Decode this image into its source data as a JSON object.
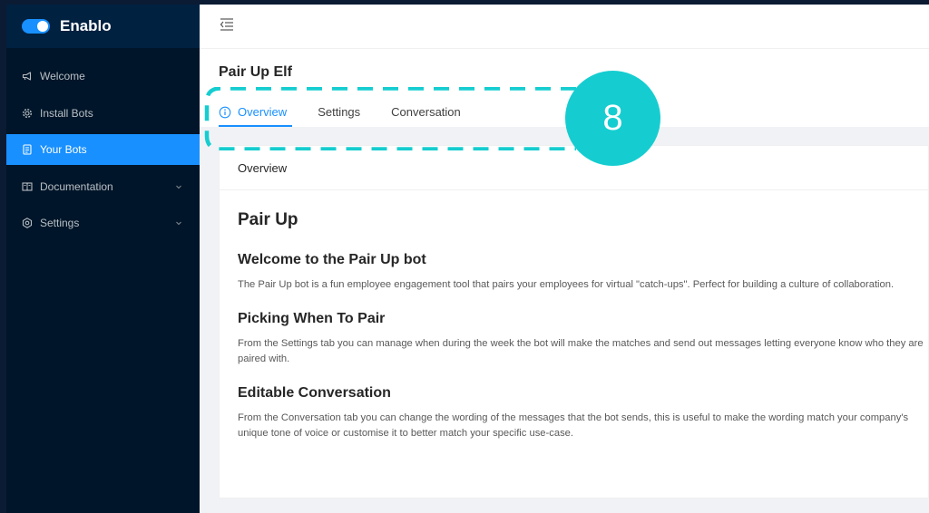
{
  "app": {
    "brand": "Enablo"
  },
  "sidebar": {
    "items": [
      {
        "label": "Welcome",
        "icon": "notification-icon"
      },
      {
        "label": "Install Bots",
        "icon": "gear-icon"
      },
      {
        "label": "Your Bots",
        "icon": "bot-icon",
        "active": true
      },
      {
        "label": "Documentation",
        "icon": "book-icon"
      },
      {
        "label": "Settings",
        "icon": "settings-icon"
      }
    ]
  },
  "header": {
    "menu_icon": "menu-fold-icon"
  },
  "page": {
    "title": "Pair Up Elf",
    "tabs": [
      {
        "label": "Overview",
        "active": true,
        "icon": "info-icon"
      },
      {
        "label": "Settings"
      },
      {
        "label": "Conversation"
      }
    ]
  },
  "card": {
    "title": "Overview",
    "heading": "Pair Up",
    "sections": [
      {
        "title": "Welcome to the Pair Up bot",
        "text": "The Pair Up bot is a fun employee engagement tool that pairs your employees for virtual \"catch-ups\". Perfect for building a culture of collaboration."
      },
      {
        "title": "Picking When To Pair",
        "text": "From the Settings tab you can manage when during the week the bot will make the matches and send out messages letting everyone know who they are paired with."
      },
      {
        "title": "Editable Conversation",
        "text": "From the Conversation tab you can change the wording of the messages that the bot sends, this is useful to make the wording match your company's unique tone of voice or customise it to better match your specific use-case."
      }
    ]
  },
  "annotation": {
    "step": "8"
  },
  "colors": {
    "accent": "#1890ff",
    "sidebar": "#001529",
    "highlight": "#15cdd0"
  }
}
